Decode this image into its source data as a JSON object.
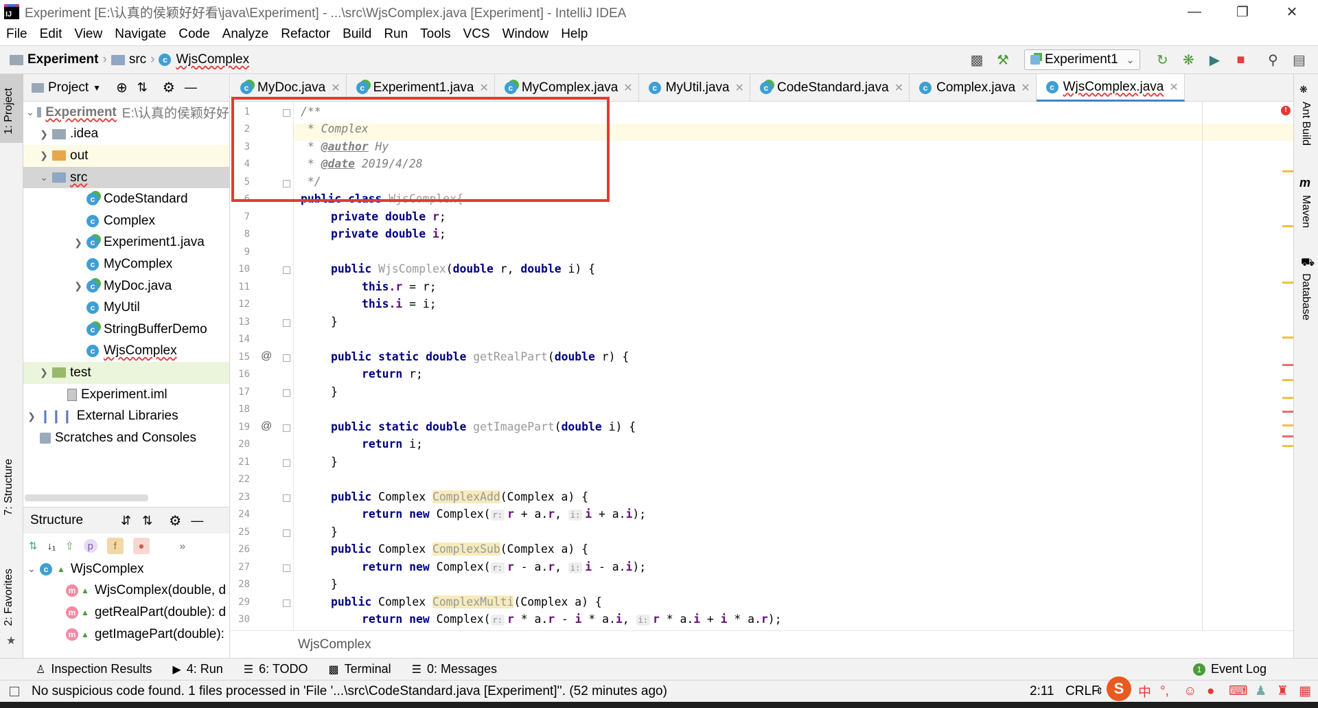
{
  "window": {
    "title": "Experiment [E:\\认真的侯颖好好看\\java\\Experiment] - ...\\src\\WjsComplex.java [Experiment] - IntelliJ IDEA",
    "app_icon_text": "IJ"
  },
  "menu": [
    "File",
    "Edit",
    "View",
    "Navigate",
    "Code",
    "Analyze",
    "Refactor",
    "Build",
    "Run",
    "Tools",
    "VCS",
    "Window",
    "Help"
  ],
  "breadcrumb": {
    "project": "Experiment",
    "folder": "src",
    "file": "WjsComplex"
  },
  "run_config": "Experiment1",
  "left_strip": {
    "project_tab": "1: Project",
    "structure_tab": "7: Structure",
    "favorites_tab": "2: Favorites"
  },
  "project_panel": {
    "title": "Project",
    "tree": [
      {
        "label": "Experiment",
        "extra": "E:\\认真的侯颖好好",
        "kind": "module"
      },
      {
        "label": ".idea",
        "kind": "folder"
      },
      {
        "label": "out",
        "kind": "folder"
      },
      {
        "label": "src",
        "kind": "folder"
      },
      {
        "label": "CodeStandard",
        "kind": "class"
      },
      {
        "label": "Complex",
        "kind": "class"
      },
      {
        "label": "Experiment1.java",
        "kind": "class"
      },
      {
        "label": "MyComplex",
        "kind": "class"
      },
      {
        "label": "MyDoc.java",
        "kind": "class"
      },
      {
        "label": "MyUtil",
        "kind": "class"
      },
      {
        "label": "StringBufferDemo",
        "kind": "class"
      },
      {
        "label": "WjsComplex",
        "kind": "class"
      },
      {
        "label": "test",
        "kind": "folder"
      },
      {
        "label": "Experiment.iml",
        "kind": "file"
      },
      {
        "label": "External Libraries",
        "kind": "lib"
      },
      {
        "label": "Scratches and Consoles",
        "kind": "scratch"
      }
    ]
  },
  "structure_panel": {
    "title": "Structure",
    "filter_letters": {
      "p": "p",
      "f": "f"
    },
    "root": "WjsComplex",
    "members": [
      "WjsComplex(double, d",
      "getRealPart(double): d",
      "getImagePart(double):"
    ]
  },
  "tabs": [
    "MyDoc.java",
    "Experiment1.java",
    "MyComplex.java",
    "MyUtil.java",
    "CodeStandard.java",
    "Complex.java",
    "WjsComplex.java"
  ],
  "active_tab": "WjsComplex.java",
  "editor": {
    "line_numbers": [
      "1",
      "2",
      "3",
      "4",
      "5",
      "6",
      "7",
      "8",
      "9",
      "10",
      "11",
      "12",
      "13",
      "14",
      "15",
      "16",
      "17",
      "18",
      "19",
      "20",
      "21",
      "22",
      "23",
      "24",
      "25",
      "26",
      "27",
      "28",
      "29",
      "30"
    ],
    "at_marks": [
      "@",
      "@"
    ],
    "code": {
      "l1": "/**",
      "l2": " * Complex",
      "l3a": " * ",
      "l3tag": "@author",
      "l3b": " Hy",
      "l4a": " * ",
      "l4tag": "@date",
      "l4b": " 2019/4/28",
      "l5": " */",
      "l6kw": "public class",
      "l6name": " WjsComplex{",
      "kw_private": "private",
      "kw_double": "double",
      "f_r": "r",
      "f_i": "i",
      "semi": ";",
      "kw_public": "public",
      "kw_this": "this",
      "kw_public_static": "public static",
      "kw_return": "return",
      "kw_new": "new",
      "ctor_name": "WjsComplex",
      "open": "(",
      "comma": ", ",
      "close_brace_open": ") {",
      "close": "}",
      "dot_r": ".r",
      "dot_i": ".i",
      "assign_r": " = r;",
      "assign_i": " = i;",
      "m_getReal": "getRealPart",
      "m_getImage": "getImagePart",
      "ret_r": " r;",
      "ret_i": " i;",
      "type_complex": "Complex",
      "param_a": "(Complex a) {",
      "m_add": "ComplexAdd",
      "m_sub": "ComplexSub",
      "m_multi": "ComplexMulti",
      "complex_open": " Complex(",
      "hint_r": "r:",
      "hint_i": "i:",
      "add_r": " + a.",
      "add_i": " + a.",
      "sub_op": " - a.",
      "end_call": ");",
      "mul_a": " * a.",
      "mul_minus": " - ",
      "mul_times": " * a.",
      "mul_plus": " + ",
      "end_call_multi": ");"
    },
    "footer": "WjsComplex"
  },
  "right_strip": {
    "ant": "Ant Build",
    "maven": "Maven",
    "database": "Database"
  },
  "tool_tabs": [
    "Inspection Results",
    "4: Run",
    "6: TODO",
    "Terminal",
    "0: Messages",
    "Event Log"
  ],
  "status": {
    "message": "No suspicious code found. 1 files processed in 'File '...\\src\\CodeStandard.java [Experiment]''. (52 minutes ago)",
    "position": "2:11",
    "line_sep": "CRLF",
    "ime": "中"
  },
  "colors": {
    "accent": "#4083c9",
    "annotation_box": "#e53935",
    "keyword": "#000080",
    "field": "#660e7a"
  }
}
